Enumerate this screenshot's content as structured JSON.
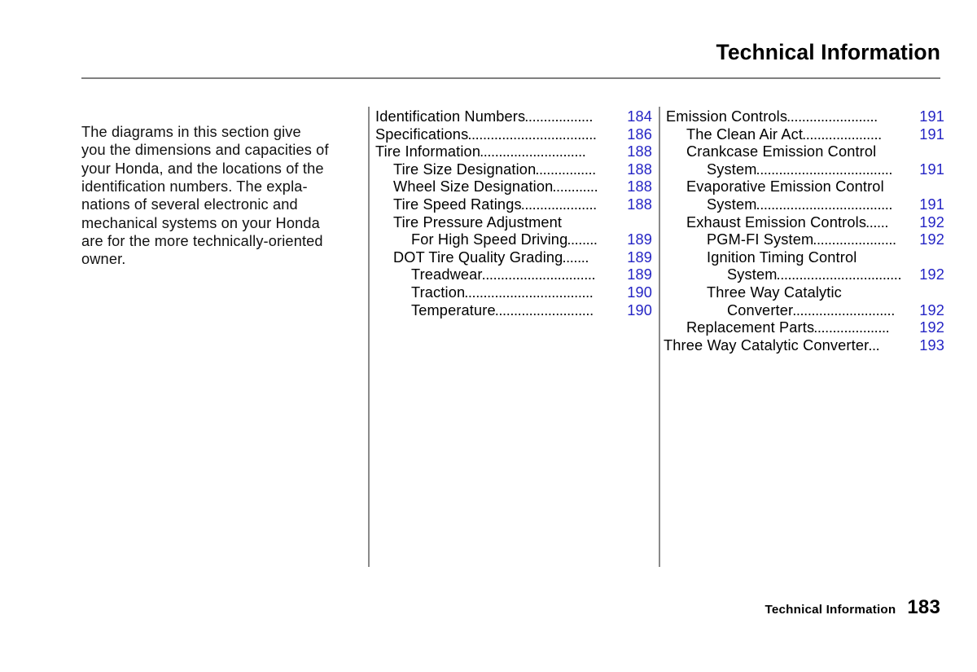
{
  "header": {
    "title": "Technical Information"
  },
  "intro": {
    "paragraph": "The diagrams in this section give\nyou the dimensions and capacities of\nyour Honda, and the locations of the\nidentification numbers. The expla-\nnations of several electronic and\nmechanical systems on your Honda\nare for the more technically-oriented\nowner."
  },
  "toc_column_1": [
    {
      "label": "Identification Numbers",
      "leader": "..................",
      "page": "184",
      "level": 0
    },
    {
      "label": "Specifications",
      "leader": "..................................",
      "page": "186",
      "level": 0
    },
    {
      "label": "Tire Information",
      "leader": "............................",
      "page": "188",
      "level": 0
    },
    {
      "label": "Tire Size Designation",
      "leader": "................",
      "page": "188",
      "level": 1
    },
    {
      "label": "Wheel Size Designation",
      "leader": "............",
      "page": "188",
      "level": 1
    },
    {
      "label": "Tire Speed Ratings",
      "leader": "....................",
      "page": "188",
      "level": 1
    },
    {
      "label": "Tire  Pressure  Adjustment",
      "leader": "",
      "page": "",
      "level": 1
    },
    {
      "label": "For High Speed Driving",
      "leader": "........",
      "page": "189",
      "level": 2
    },
    {
      "label": "DOT Tire Quality Grading",
      "leader": ".......",
      "page": "189",
      "level": 1
    },
    {
      "label": "Treadwear",
      "leader": "..............................",
      "page": "189",
      "level": 2
    },
    {
      "label": "Traction",
      "leader": "..................................",
      "page": "190",
      "level": 2
    },
    {
      "label": "Temperature",
      "leader": "..........................",
      "page": "190",
      "level": 2
    }
  ],
  "toc_column_2": [
    {
      "label": "Emission Controls",
      "leader": "........................",
      "page": "191",
      "level": 0
    },
    {
      "label": "The Clean Air Act",
      "leader": ".....................",
      "page": "191",
      "level": 1
    },
    {
      "label": "Crankcase  Emission  Control",
      "leader": "",
      "page": "",
      "level": 1
    },
    {
      "label": "System",
      "leader": "....................................",
      "page": "191",
      "level": 2
    },
    {
      "label": "Evaporative  Emission  Control",
      "leader": "",
      "page": "",
      "level": 1
    },
    {
      "label": "System",
      "leader": "....................................",
      "page": "191",
      "level": 2
    },
    {
      "label": "Exhaust Emission Controls",
      "leader": "......",
      "page": "192",
      "level": 1
    },
    {
      "label": "PGM-FI System",
      "leader": "......................",
      "page": "192",
      "level": 2
    },
    {
      "label": "Ignition  Timing  Control",
      "leader": "",
      "page": "",
      "level": 2
    },
    {
      "label": "System",
      "leader": ".................................",
      "page": "192",
      "level": 3
    },
    {
      "label": "Three  Way  Catalytic",
      "leader": "",
      "page": "",
      "level": 2
    },
    {
      "label": "Converter",
      "leader": "...........................",
      "page": "192",
      "level": 3
    },
    {
      "label": "Replacement Parts",
      "leader": "....................",
      "page": "192",
      "level": 1
    },
    {
      "label": "Three Way Catalytic Converter",
      "leader": "...",
      "page": "193",
      "level": -1
    }
  ],
  "footer": {
    "section": "Technical Information",
    "page_number": "183"
  },
  "colors": {
    "page_number_blue": "#2424c4",
    "rule_gray": "#808080",
    "text_black": "#000000"
  }
}
